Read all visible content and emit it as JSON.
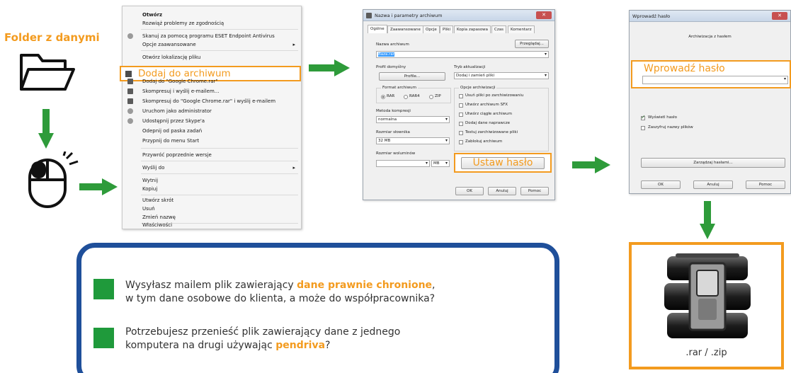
{
  "folder": {
    "title": "Folder z danymi"
  },
  "context_menu": {
    "items": [
      "Otwórz",
      "Rozwiąż problemy ze zgodnością",
      "Skanuj za pomocą programu ESET Endpoint Antivirus",
      "Opcje zaawansowane",
      "Otwórz lokalizację pliku",
      "Dodaj do archiwum",
      "Dodaj do \"Google Chrome.rar\"",
      "Skompresuj i wyślij e-mailem...",
      "Skompresuj do \"Google Chrome.rar\" i wyślij e-mailem",
      "Uruchom jako administrator",
      "Udostępnij przez Skype'a",
      "Odepnij od paska zadań",
      "Przypnij do menu Start",
      "Przywróć poprzednie wersje",
      "Wyślij do",
      "Wytnij",
      "Kopiuj",
      "Utwórz skrót",
      "Usuń",
      "Zmień nazwę",
      "Właściwości"
    ],
    "highlighted_label": "Dodaj do archiwum"
  },
  "archive_dialog": {
    "title": "Nazwa i parametry archiwum",
    "tabs": [
      "Ogólne",
      "Zaawansowane",
      "Opcje",
      "Pliki",
      "Kopia zapasowa",
      "Czas",
      "Komentarz"
    ],
    "archive_name_label": "Nazwa archiwum",
    "browse_button": "Przeglądaj...",
    "archive_name_value": "Baza.rar",
    "default_profile_label": "Profil domyślny",
    "profiles_button": "Profile...",
    "update_mode_label": "Tryb aktualizacji",
    "update_mode_value": "Dodaj i zamień pliki",
    "format_label": "Format archiwum",
    "formats": [
      "RAR",
      "RAR4",
      "ZIP"
    ],
    "selected_format": "RAR",
    "options_label": "Opcje archiwizacji",
    "options": [
      "Usuń pliki po zarchiwizowaniu",
      "Utwórz archiwum SFX",
      "Utwórz ciągłe archiwum",
      "Dodaj dane naprawcze",
      "Testuj zarchiwizowane pliki",
      "Zablokuj archiwum"
    ],
    "compression_label": "Metoda kompresji",
    "compression_value": "normalna",
    "dictionary_label": "Rozmiar słownika",
    "dictionary_value": "32 MB",
    "volume_label": "Rozmiar woluminów",
    "volume_unit": "MB",
    "set_password_button": "Ustaw hasło",
    "ok_button": "OK",
    "cancel_button": "Anuluj",
    "help_button": "Pomoc"
  },
  "password_dialog": {
    "title": "Wprowadź hasło",
    "subtitle": "Archiwizacja z hasłem",
    "field_label": "Wprowadź hasło",
    "show_password_label": "Wyświetl hasło",
    "show_password_checked": true,
    "encrypt_names_label": "Zaszyfruj nazwy plików",
    "encrypt_names_checked": false,
    "manage_button": "Zarządzaj hasłami...",
    "ok_button": "OK",
    "cancel_button": "Anuluj",
    "help_button": "Pomoc"
  },
  "info": {
    "q1_before": "Wysyłasz mailem plik zawierający ",
    "q1_highlight": "dane prawnie chronione",
    "q1_after": ",",
    "q1_line2": "w tym dane osobowe do klienta, a może do współpracownika?",
    "q2_line1": "Potrzebujesz przenieść plik zawierający dane z jednego",
    "q2_before": "komputera na drugi używając ",
    "q2_highlight": "pendriva",
    "q2_after": "?"
  },
  "result": {
    "label": ".rar / .zip"
  },
  "colors": {
    "accent": "#f39b1f",
    "arrow": "#2e9b3a",
    "panel_border": "#1f4f9a",
    "bullet": "#1f9a3b"
  }
}
